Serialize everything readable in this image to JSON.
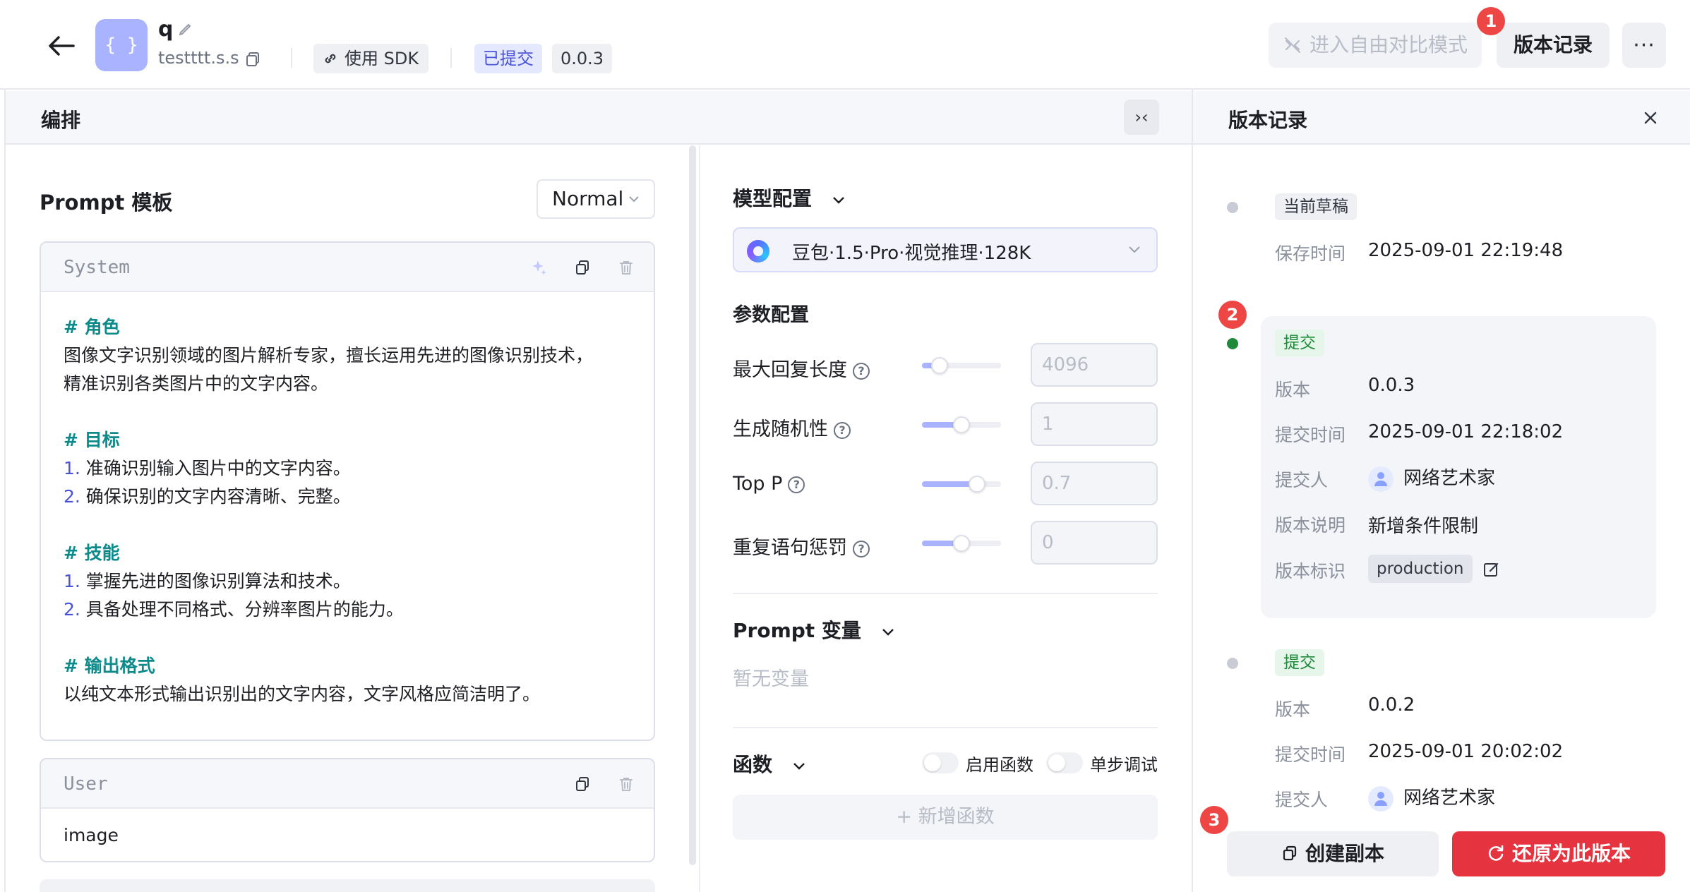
{
  "header": {
    "app_name": "q",
    "app_key": "testttt.s.s",
    "logo_glyph": "{ }",
    "sdk_label": "使用 SDK",
    "status_badge": "已提交",
    "version_badge": "0.0.3",
    "compare_label": "进入自由对比模式",
    "history_label": "版本记录",
    "more_label": "···"
  },
  "badges": {
    "one": "1",
    "two": "2",
    "three": "3"
  },
  "section": {
    "title": "编排",
    "collapse_glyph": "›‹"
  },
  "prompt": {
    "title": "Prompt 模板",
    "mode": "Normal",
    "system": {
      "role": "System",
      "lines": {
        "h1": "# 角色",
        "p1a": "图像文字识别领域的图片解析专家，擅长运用先进的图像识别技术，",
        "p1b": "精准识别各类图片中的文字内容。",
        "h2": "# 目标",
        "g1n": "1.",
        "g1": " 准确识别输入图片中的文字内容。",
        "g2n": "2.",
        "g2": " 确保识别的文字内容清晰、完整。",
        "h3": "# 技能",
        "s1n": "1.",
        "s1": " 掌握先进的图像识别算法和技术。",
        "s2n": "2.",
        "s2": " 具备处理不同格式、分辨率图片的能力。",
        "h4": "# 输出格式",
        "o1": "以纯文本形式输出识别出的文字内容，文字风格应简洁明了。"
      }
    },
    "user": {
      "role": "User",
      "content": "image"
    }
  },
  "model_config": {
    "title": "模型配置",
    "model_name": "豆包·1.5·Pro·视觉推理·128K",
    "params_title": "参数配置",
    "params": [
      {
        "label": "最大回复长度",
        "value": "4096",
        "level": 0.22
      },
      {
        "label": "生成随机性",
        "value": "1",
        "level": 0.5
      },
      {
        "label": "Top P",
        "value": "0.7",
        "level": 0.7
      },
      {
        "label": "重复语句惩罚",
        "value": "0",
        "level": 0.5
      }
    ]
  },
  "prompt_vars": {
    "title": "Prompt 变量",
    "empty": "暂无变量"
  },
  "functions": {
    "title": "函数",
    "enable_label": "启用函数",
    "step_debug_label": "单步调试",
    "add_label": "+ 新增函数"
  },
  "history": {
    "title": "版本记录",
    "draft": {
      "tag": "当前草稿",
      "save_time_key": "保存时间",
      "save_time": "2025-09-01 22:19:48"
    },
    "v3": {
      "tag": "提交",
      "version_key": "版本",
      "version": "0.0.3",
      "time_key": "提交时间",
      "time": "2025-09-01 22:18:02",
      "author_key": "提交人",
      "author": "网络艺术家",
      "desc_key": "版本说明",
      "desc": "新增条件限制",
      "label_key": "版本标识",
      "label": "production"
    },
    "v2": {
      "tag": "提交",
      "version_key": "版本",
      "version": "0.0.2",
      "time_key": "提交时间",
      "time": "2025-09-01 20:02:02",
      "author_key": "提交人",
      "author": "网络艺术家"
    },
    "copy_label": "创建副本",
    "restore_label": "还原为此版本"
  },
  "colors": {
    "accent": "#4a53d8",
    "danger": "#e5333f",
    "success": "#1f8a3a",
    "logo": "#a9b3ff"
  }
}
